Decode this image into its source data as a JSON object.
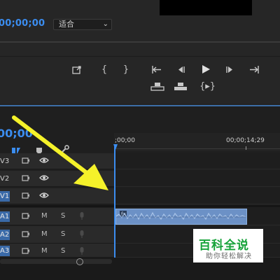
{
  "monitor": {
    "timecode": "00;00;00",
    "fit_label": "适合",
    "controls_row1": [
      "export-frame",
      "mark-in",
      "mark-out",
      "go-to-in",
      "step-back",
      "play",
      "step-forward",
      "go-to-out"
    ],
    "controls_row2": [
      "lift",
      "extract",
      "trim-toggle"
    ]
  },
  "timeline": {
    "timecode": "00;00",
    "ruler_start": ";00;00",
    "ruler_end": "00;00;14;29",
    "tracks": [
      {
        "label": "V3",
        "type": "video",
        "active": false
      },
      {
        "label": "V2",
        "type": "video",
        "active": false
      },
      {
        "label": "V1",
        "type": "video",
        "active": true
      },
      {
        "label": "A1",
        "type": "audio",
        "active": true,
        "m": "M",
        "s": "S"
      },
      {
        "label": "A2",
        "type": "audio",
        "active": true,
        "m": "M",
        "s": "S"
      },
      {
        "label": "A3",
        "type": "audio",
        "active": true,
        "m": "M",
        "s": "S"
      }
    ]
  },
  "watermark": {
    "title": "百科全说",
    "subtitle": "助你轻松解决"
  },
  "colors": {
    "accent": "#3b8df0",
    "arrow": "#f5f22a",
    "clip": "#6c91c6",
    "watermark_green": "#17a33a"
  }
}
